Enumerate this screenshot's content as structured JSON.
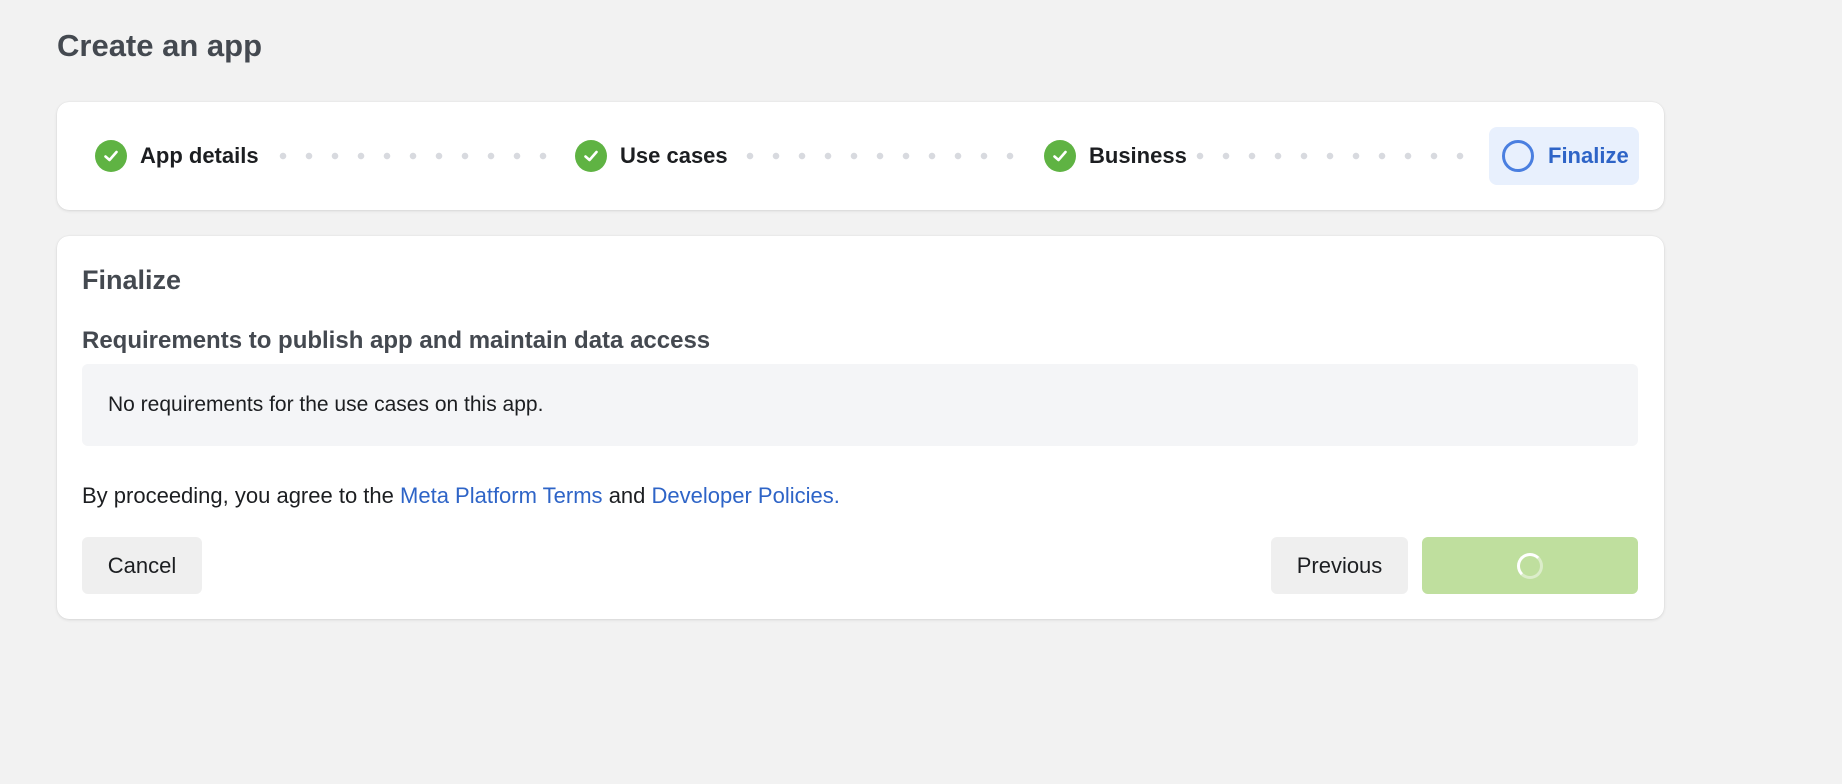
{
  "page": {
    "title": "Create an app"
  },
  "stepper": {
    "steps": [
      {
        "label": "App details",
        "status": "complete"
      },
      {
        "label": "Use cases",
        "status": "complete"
      },
      {
        "label": "Business",
        "status": "complete"
      },
      {
        "label": "Finalize",
        "status": "active"
      }
    ],
    "colors": {
      "complete": "#5fb343",
      "active": "#2e64c7",
      "active_bg": "#e8f0fd"
    }
  },
  "finalize": {
    "title": "Finalize",
    "requirements_heading": "Requirements to publish app and maintain data access",
    "requirements_text": "No requirements for the use cases on this app.",
    "terms": {
      "prefix": "By proceeding, you agree to the",
      "link1": "Meta Platform Terms",
      "conjunction": "and",
      "link2": "Developer Policies."
    }
  },
  "actions": {
    "cancel_label": "Cancel",
    "previous_label": "Previous",
    "create_state": "loading",
    "create_color": "#bfdf9e"
  }
}
